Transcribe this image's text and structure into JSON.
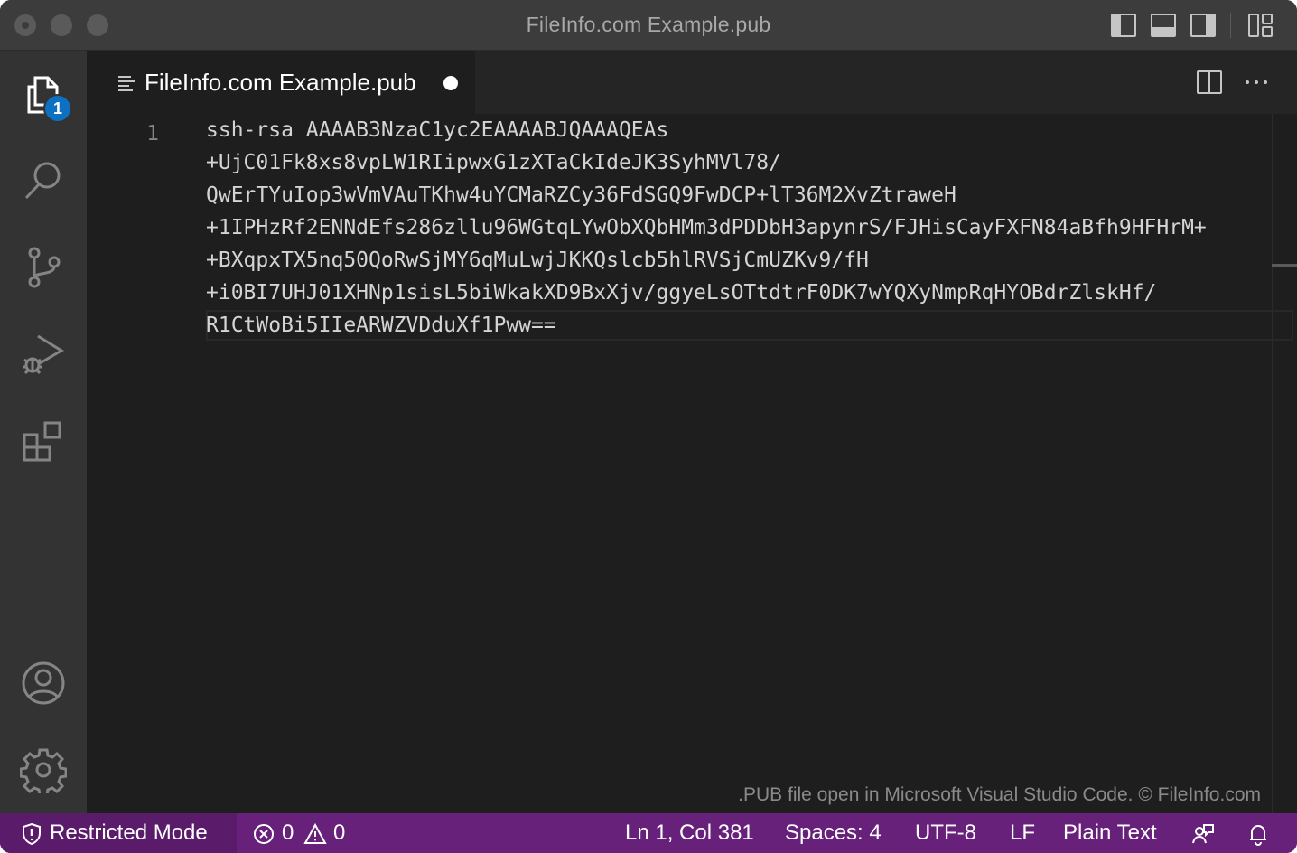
{
  "window": {
    "title": "FileInfo.com Example.pub"
  },
  "activity_bar": {
    "explorer_badge": "1",
    "items": [
      "files-icon",
      "search-icon",
      "source-control-icon",
      "run-debug-icon",
      "extensions-icon",
      "account-icon",
      "gear-icon"
    ]
  },
  "tab": {
    "label": "FileInfo.com Example.pub",
    "dirty": true
  },
  "editor": {
    "line_number": "1",
    "lines": [
      "ssh-rsa AAAAB3NzaC1yc2EAAAABJQAAAQEAs",
      "+UjC01Fk8xs8vpLW1RIipwxG1zXTaCkIdeJK3SyhMVl78/",
      "QwErTYuIop3wVmVAuTKhw4uYCMaRZCy36FdSGQ9FwDCP+lT36M2XvZtraweH",
      "+1IPHzRf2ENNdEfs286zllu96WGtqLYwObXQbHMm3dPDDbH3apynrS/FJHisCayFXFN84aBfh9HFHrM+",
      "+BXqpxTX5nq50QoRwSjMY6qMuLwjJKKQslcb5hlRVSjCmUZKv9/fH",
      "+i0BI7UHJ01XHNp1sisL5biWkakXD9BxXjv/ggyeLsOTtdtrF0DK7wYQXyNmpRqHYOBdrZlskHf/",
      "R1CtWoBi5IIeARWZVDduXf1Pww=="
    ],
    "watermark": ".PUB file open in Microsoft Visual Studio Code. © FileInfo.com"
  },
  "status_bar": {
    "restricted_mode": "Restricted Mode",
    "errors": "0",
    "warnings": "0",
    "cursor_position": "Ln 1, Col 381",
    "spaces": "Spaces: 4",
    "encoding": "UTF-8",
    "eol": "LF",
    "language": "Plain Text"
  },
  "colors": {
    "status_bar": "#68217a",
    "restricted_bg": "#5a1c6a",
    "badge": "#0e70c0",
    "editor_bg": "#1e1e1e",
    "activity_bar": "#333333"
  }
}
